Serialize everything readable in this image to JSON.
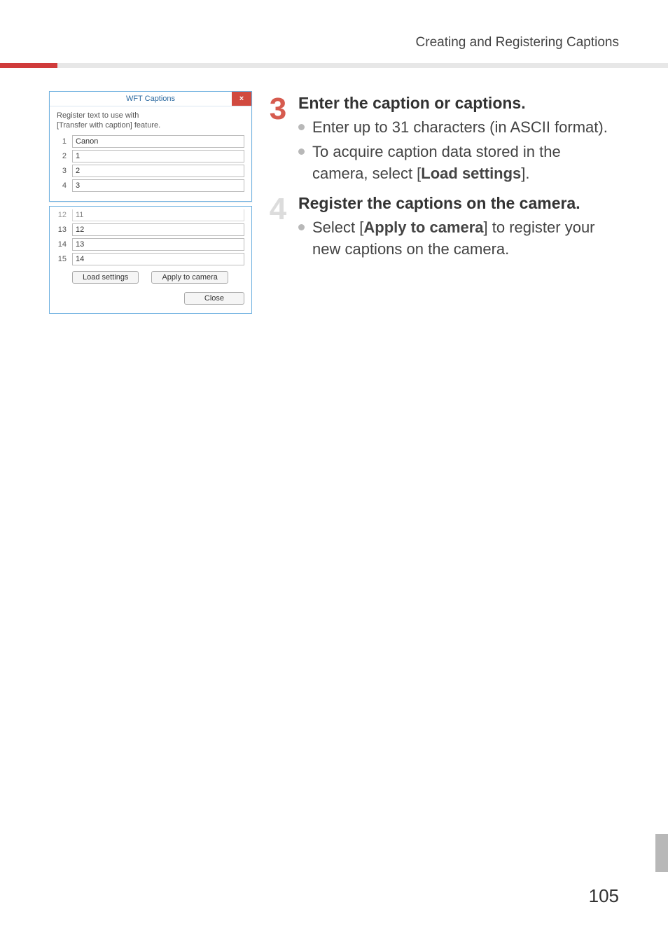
{
  "header": {
    "section_title": "Creating and Registering Captions"
  },
  "dialog": {
    "title": "WFT Captions",
    "close_glyph": "×",
    "instruction_line1": "Register text to use with",
    "instruction_line2": "[Transfer with caption] feature.",
    "rows_top": [
      {
        "num": "1",
        "value": "Canon"
      },
      {
        "num": "2",
        "value": "1"
      },
      {
        "num": "3",
        "value": "2"
      },
      {
        "num": "4",
        "value": "3"
      }
    ],
    "rows_bottom": [
      {
        "num": "12",
        "value": "11"
      },
      {
        "num": "13",
        "value": "12"
      },
      {
        "num": "14",
        "value": "13"
      },
      {
        "num": "15",
        "value": "14"
      }
    ],
    "load_settings_label": "Load settings",
    "apply_to_camera_label": "Apply to camera",
    "close_label": "Close"
  },
  "steps": {
    "s3": {
      "num": "3",
      "title": "Enter the caption or captions.",
      "b1": "Enter up to 31 characters (in ASCII format).",
      "b2_pre": "To acquire caption data stored in the camera, select [",
      "b2_bold": "Load settings",
      "b2_post": "]."
    },
    "s4": {
      "num": "4",
      "title": "Register the captions on the camera.",
      "b1_pre": "Select [",
      "b1_bold": "Apply to camera",
      "b1_post": "] to register your new captions on the camera."
    }
  },
  "page_number": "105"
}
